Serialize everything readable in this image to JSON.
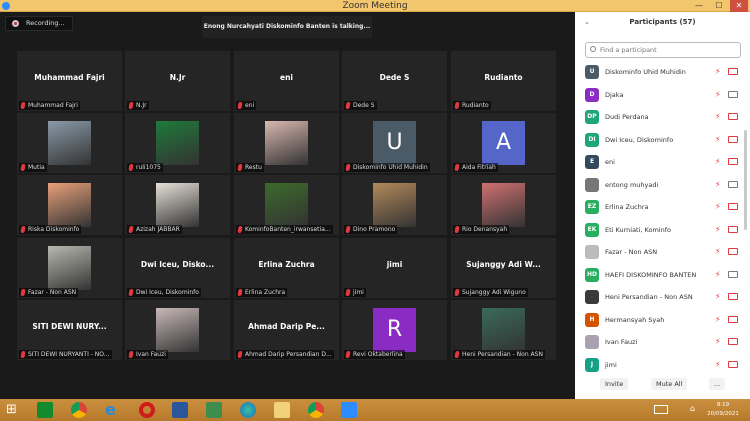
{
  "window": {
    "title": "Zoom Meeting",
    "minimize": "—",
    "maximize": "☐",
    "close": "✕"
  },
  "recording": {
    "label": "Recording..."
  },
  "talking": {
    "text": "Enong Nurcahyati Diskominfo Banten is talking..."
  },
  "tiles": [
    {
      "name": "Muhammad Fajri",
      "big": "Muhammad Fajri"
    },
    {
      "name": "N.Jr",
      "big": "N.Jr"
    },
    {
      "name": "eni",
      "big": "eni"
    },
    {
      "name": "Dede S",
      "big": "Dede S"
    },
    {
      "name": "Rudianto",
      "big": "Rudianto"
    },
    {
      "name": "Mutia",
      "video": "#8a9aa8"
    },
    {
      "name": "ruli1075",
      "video": "#1f7a3a"
    },
    {
      "name": "Restu",
      "video": "#d9b7b0"
    },
    {
      "name": "Diskominfo Uhid Muhidin",
      "letter": "U",
      "color": "#4a5a66"
    },
    {
      "name": "Aida Fitriah",
      "letter": "A",
      "color": "#5565c8"
    },
    {
      "name": "Riska Diskominfo",
      "video": "#e8a07a"
    },
    {
      "name": "Azizah JABBAR",
      "video": "#e6e0d8"
    },
    {
      "name": "KominfoBanten_irwansetia...",
      "video": "#3c6a2a"
    },
    {
      "name": "Dino Pramono",
      "video": "#b38a5a"
    },
    {
      "name": "Rio Denansyah",
      "video": "#d07070"
    },
    {
      "name": "Fazar - Non ASN",
      "video": "#b8b8b0"
    },
    {
      "name": "Dwi Iceu, Diskominfo",
      "big": "Dwi Iceu, Disko..."
    },
    {
      "name": "Erlina Zuchra",
      "big": "Erlina Zuchra"
    },
    {
      "name": "jimi",
      "big": "jimi"
    },
    {
      "name": "Sujanggy Adi Wiguno",
      "big": "Sujanggy Adi W..."
    },
    {
      "name": "SITI DEWI NURYANTI - NO...",
      "big": "SITI DEWI NURY..."
    },
    {
      "name": "Ivan Fauzi",
      "video": "#c8b8b8"
    },
    {
      "name": "Ahmad Darip Persandian D...",
      "big": "Ahmad Darip Pe..."
    },
    {
      "name": "Revi Oktaberlina",
      "letter": "R",
      "color": "#8a2bc4"
    },
    {
      "name": "Heni Persandian - Non ASN",
      "video": "#3a6a5a"
    }
  ],
  "participants": {
    "title": "Participants (57)",
    "search_placeholder": "Find a participant",
    "list": [
      {
        "initials": "U",
        "name": "Diskominfo Uhid Muhidin",
        "color": "#4a5a66",
        "video": false
      },
      {
        "initials": "D",
        "name": "Djaka",
        "color": "#8a2bc4",
        "video": true
      },
      {
        "initials": "DP",
        "name": "Dudi Perdana",
        "color": "#1fa57a",
        "video": false
      },
      {
        "initials": "DI",
        "name": "Dwi Iceu, Diskominfo",
        "color": "#1fa57a",
        "video": false
      },
      {
        "initials": "E",
        "name": "eni",
        "color": "#34495e",
        "video": false
      },
      {
        "initials": "",
        "name": "entong muhyadi",
        "color": "#777777",
        "video": true
      },
      {
        "initials": "EZ",
        "name": "Erlina Zuchra",
        "color": "#27ae60",
        "video": false
      },
      {
        "initials": "EK",
        "name": "Eti Kurniati, Kominfo",
        "color": "#27ae60",
        "video": false
      },
      {
        "initials": "",
        "name": "Fazar - Non ASN",
        "color": "#bbbbbb",
        "video": false
      },
      {
        "initials": "HD",
        "name": "HAEFI DISKOMINFO BANTEN",
        "color": "#27ae60",
        "video": true
      },
      {
        "initials": "",
        "name": "Heni Persandian - Non ASN",
        "color": "#3a3a3a",
        "video": false
      },
      {
        "initials": "H",
        "name": "Hermansyah Syah",
        "color": "#d35400",
        "video": false
      },
      {
        "initials": "",
        "name": "Ivan Fauzi",
        "color": "#a9a0b0",
        "video": false
      },
      {
        "initials": "J",
        "name": "jimi",
        "color": "#16a085",
        "video": false
      }
    ],
    "invite": "Invite",
    "mute_all": "Mute All",
    "more": "..."
  },
  "taskbar": {
    "time": "8:19",
    "date": "20/09/2021"
  }
}
